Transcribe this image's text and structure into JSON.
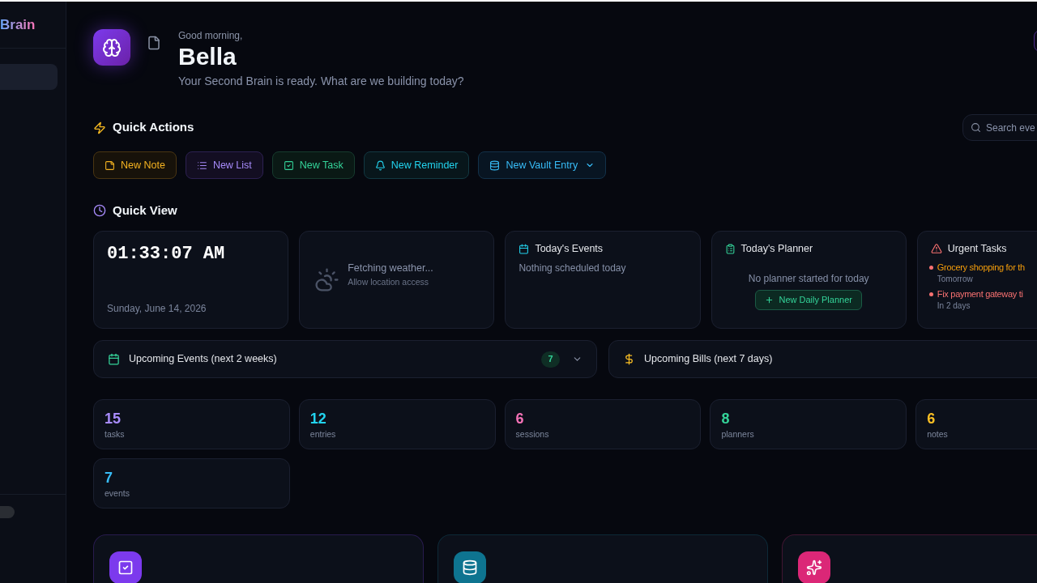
{
  "sidebar": {
    "title": "Brain",
    "items": [
      {
        "selected": true
      }
    ]
  },
  "header": {
    "greeting": "Good morning,",
    "name": "Bella",
    "subtitle": "Your Second Brain is ready. What are we building today?"
  },
  "quick_actions": {
    "title": "Quick Actions",
    "search": {
      "placeholder": "Search eve"
    },
    "buttons": [
      {
        "kind": "note",
        "label": "New Note"
      },
      {
        "kind": "list",
        "label": "New List"
      },
      {
        "kind": "task",
        "label": "New Task"
      },
      {
        "kind": "reminder",
        "label": "New Reminder"
      },
      {
        "kind": "vault",
        "label": "New Vault Entry",
        "dropdown": true
      }
    ]
  },
  "quick_view": {
    "title": "Quick View",
    "clock": {
      "time": "01:33:07 AM",
      "date": "Sunday, June 14, 2026"
    },
    "weather": {
      "status": "Fetching weather...",
      "hint": "Allow location access"
    },
    "todays_events": {
      "title": "Today's Events",
      "empty_text": "Nothing scheduled today"
    },
    "todays_planner": {
      "title": "Today's Planner",
      "empty_text": "No planner started for today",
      "button": "New Daily Planner"
    },
    "urgent_tasks": {
      "title": "Urgent Tasks",
      "items": [
        {
          "title": "Grocery shopping for th",
          "due": "Tomorrow",
          "color": "#f59e0b"
        },
        {
          "title": "Fix payment gateway ti",
          "due": "In 2 days",
          "color": "#f87171"
        }
      ]
    }
  },
  "panels": [
    {
      "kind": "events",
      "title": "Upcoming Events (next 2 weeks)",
      "badge": "7",
      "expanded": false
    },
    {
      "kind": "bills",
      "title": "Upcoming Bills (next 7 days)"
    }
  ],
  "stats": [
    {
      "value": "15",
      "label": "tasks",
      "color": "#a78bfa"
    },
    {
      "value": "12",
      "label": "entries",
      "color": "#22d3ee"
    },
    {
      "value": "6",
      "label": "sessions",
      "color": "#f472b6"
    },
    {
      "value": "8",
      "label": "planners",
      "color": "#34d399"
    },
    {
      "value": "6",
      "label": "notes",
      "color": "#fbbf24"
    },
    {
      "value": "7",
      "label": "events",
      "color": "#38bdf8"
    }
  ],
  "feature_cards": [
    {
      "kind": "tasks",
      "color": "#7c3aed"
    },
    {
      "kind": "vault",
      "color": "#0e7490"
    },
    {
      "kind": "ai",
      "color": "#db2777"
    }
  ]
}
